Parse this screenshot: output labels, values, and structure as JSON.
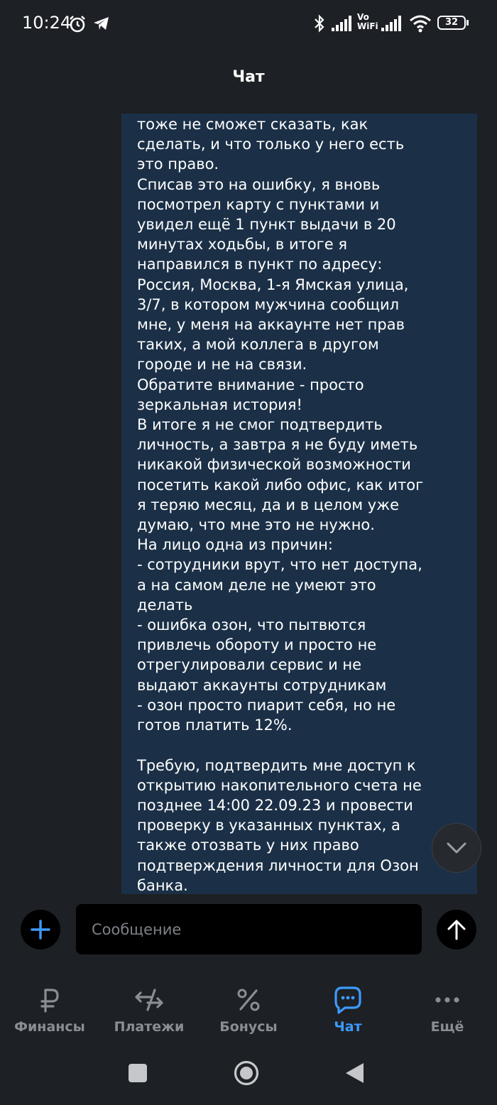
{
  "status_bar": {
    "time": "10:24",
    "icons": [
      "alarm-icon",
      "telegram-icon",
      "bluetooth-icon",
      "signal-icon",
      "vowifi-icon",
      "wifi-icon",
      "battery-icon"
    ],
    "vowifi_top": "Vo",
    "vowifi_bottom": "WiFi",
    "battery": "32"
  },
  "header": {
    "title": "Чат"
  },
  "message": {
    "text": "тоже не сможет сказать, как\nсделать, и что только у него есть\nэто право.\nСписав это на ошибку, я вновь\nпосмотрел карту с пунктами и\nувидел ещё 1 пункт выдачи в 20\nминутах ходьбы, в итоге я\nнаправился в пункт по адресу:\nРоссия, Москва, 1-я Ямская улица,\n3/7, в котором мужчина сообщил\nмне, у меня на аккаунте нет прав\nтаких, а мой коллега в другом\nгороде и не на связи.\nОбратите внимание - просто\nзеркальная история!\nВ итоге я не смог подтвердить\nличность, а завтра я не буду иметь\nникакой физической возможности\nпосетить какой либо офис, как итог\nя теряю месяц, да и в целом уже\nдумаю, что мне это не нужно.\nНа лицо одна из причин:\n- сотрудники врут, что нет доступа,\nа на самом деле не умеют это\nделать\n- ошибка озон, что пытвются\nпривлечь обороту и просто не\nотрегулировали сервис и не\nвыдают аккаунты сотрудникам\n- озон просто пиарит себя, но не\nготов платить 12%.\n\nТребую, подтвердить мне доступ к\nоткрытию накопительного счета не\nпозднее 14:00 22.09.23 и провести\nпроверку в указанных пунктах, а\nтакже отозвать у них право\nподтверждения личности для Озон\nбанка."
  },
  "composer": {
    "placeholder": "Сообщение"
  },
  "tabs": [
    {
      "label": "Финансы",
      "icon": "ruble-icon",
      "active": false
    },
    {
      "label": "Платежи",
      "icon": "transfer-arrows-icon",
      "active": false
    },
    {
      "label": "Бонусы",
      "icon": "percent-icon",
      "active": false
    },
    {
      "label": "Чат",
      "icon": "chat-icon",
      "active": true
    },
    {
      "label": "Ещё",
      "icon": "more-dots-icon",
      "active": false
    }
  ],
  "colors": {
    "background": "#1d2024",
    "bubble": "#1b3047",
    "accent": "#3d9bff",
    "tab_inactive": "#8a8e94"
  }
}
